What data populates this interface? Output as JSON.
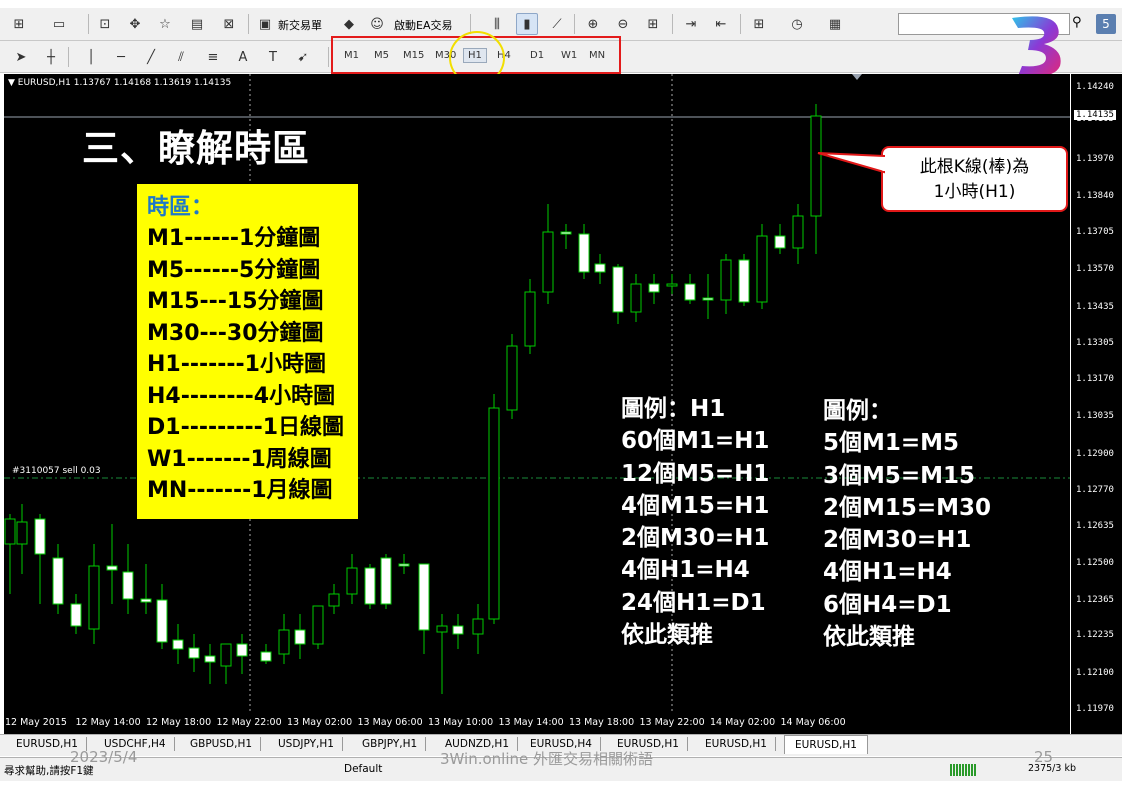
{
  "toolbar": {
    "new_order_label": "新交易單",
    "ea_label": "啟動EA交易",
    "search_placeholder": "",
    "help_label": "5"
  },
  "drawing_tools": {
    "text_tool_label": "A",
    "timeframes": [
      "M1",
      "M5",
      "M15",
      "M30",
      "H1",
      "H4",
      "D1",
      "W1",
      "MN"
    ],
    "selected_timeframe": "H1"
  },
  "chart": {
    "symbol_info": "▼ EURUSD,H1  1.13767 1.14168 1.13619 1.14135",
    "order_label": "#3110057 sell 0.03",
    "current_price": "1.14135",
    "y_ticks": [
      "1.14240",
      "1.14105",
      "1.13970",
      "1.13840",
      "1.13705",
      "1.13570",
      "1.13435",
      "1.13305",
      "1.13170",
      "1.13035",
      "1.12900",
      "1.12770",
      "1.12635",
      "1.12500",
      "1.12365",
      "1.12235",
      "1.12100",
      "1.11970"
    ],
    "x_ticks": [
      "12 May 2015",
      "12 May 14:00",
      "12 May 18:00",
      "12 May 22:00",
      "13 May 02:00",
      "13 May 06:00",
      "13 May 10:00",
      "13 May 14:00",
      "13 May 18:00",
      "13 May 22:00",
      "14 May 02:00",
      "14 May 06:00"
    ]
  },
  "slide": {
    "title": "三、瞭解時區",
    "timezone_box": {
      "heading": "時區：",
      "lines": [
        "M1------1分鐘圖",
        "M5------5分鐘圖",
        "M15---15分鐘圖",
        "M30---30分鐘圖",
        "H1-------1小時圖",
        "H4--------4小時圖",
        "D1---------1日線圖",
        "W1-------1周線圖",
        "MN-------1月線圖"
      ]
    },
    "legend_left": {
      "heading": "圖例：H1",
      "lines": [
        "60個M1=H1",
        "12個M5=H1",
        "4個M15=H1",
        "2個M30=H1",
        "4個H1=H4",
        "24個H1=D1",
        "依此類推"
      ]
    },
    "legend_right": {
      "heading": "圖例：",
      "lines": [
        "5個M1=M5",
        "3個M5=M15",
        "2個M15=M30",
        "2個M30=H1",
        "4個H1=H4",
        "6個H4=D1",
        "依此類推"
      ]
    },
    "callout": {
      "line1": "此根K線(棒)為",
      "line2": "1小時(H1)"
    }
  },
  "tabs": {
    "items": [
      "EURUSD,H1",
      "USDCHF,H4",
      "GBPUSD,H1",
      "USDJPY,H1",
      "GBPJPY,H1",
      "AUDNZD,H1",
      "EURUSD,H4",
      "EURUSD,H1",
      "EURUSD,H1",
      "EURUSD,H1"
    ],
    "active_index": 9
  },
  "status": {
    "help_text": "尋求幫助,請按F1鍵",
    "profile": "Default",
    "traffic": "2375/3 kb"
  },
  "watermark": {
    "date": "2023/5/4",
    "footer": "3Win.online 外匯交易相關術語",
    "page": "25"
  },
  "colors": {
    "accent_red": "#e31b1b",
    "highlight_yellow": "#ffff00",
    "bull_candle": "#00cc00"
  }
}
